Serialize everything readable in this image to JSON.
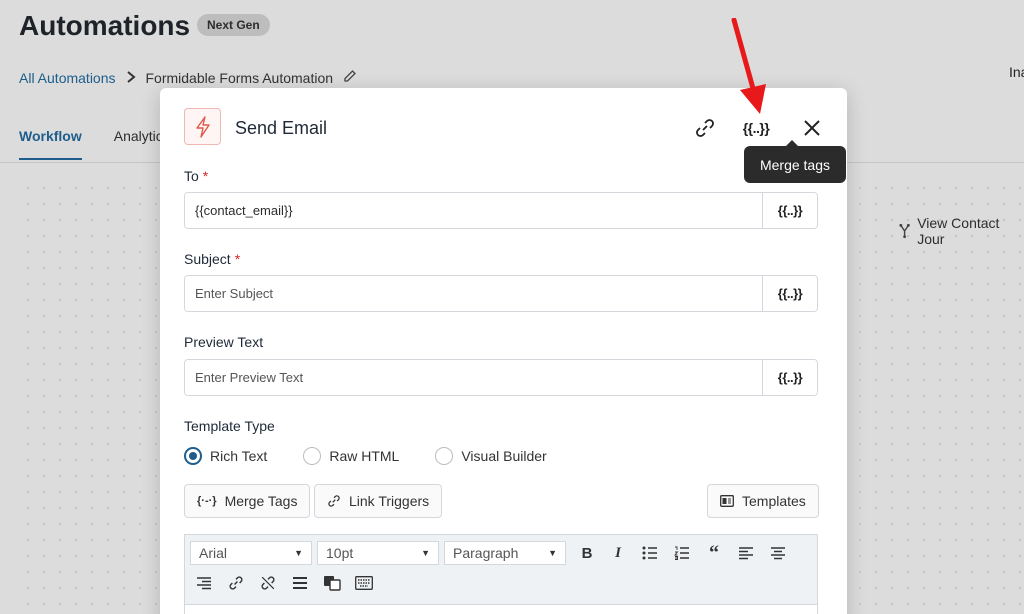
{
  "background": {
    "title": "Automations",
    "badge": "Next Gen",
    "breadcrumb_root": "All Automations",
    "breadcrumb_current": "Formidable Forms Automation",
    "right_partial": "Ina",
    "tabs": [
      "Workflow",
      "Analytics"
    ],
    "view_journey": "View Contact Jour"
  },
  "modal": {
    "title": "Send Email",
    "tooltip": "Merge tags",
    "merge_glyph": "{{..}}",
    "fields": {
      "to_label": "To",
      "to_value": "{{contact_email}}",
      "subject_label": "Subject",
      "subject_placeholder": "Enter Subject",
      "preview_label": "Preview Text",
      "preview_placeholder": "Enter Preview Text"
    },
    "template_type_label": "Template Type",
    "template_options": [
      "Rich Text",
      "Raw HTML",
      "Visual Builder"
    ],
    "selected_template": "Rich Text",
    "buttons": {
      "merge_tags": "Merge Tags",
      "link_triggers": "Link Triggers",
      "templates": "Templates"
    },
    "editor": {
      "font": "Arial",
      "size": "10pt",
      "block": "Paragraph"
    }
  },
  "colors": {
    "accent": "#1e5d8c",
    "required": "#dc2626",
    "arrow": "#e8191a",
    "tooltip_bg": "#2b2b2b"
  }
}
